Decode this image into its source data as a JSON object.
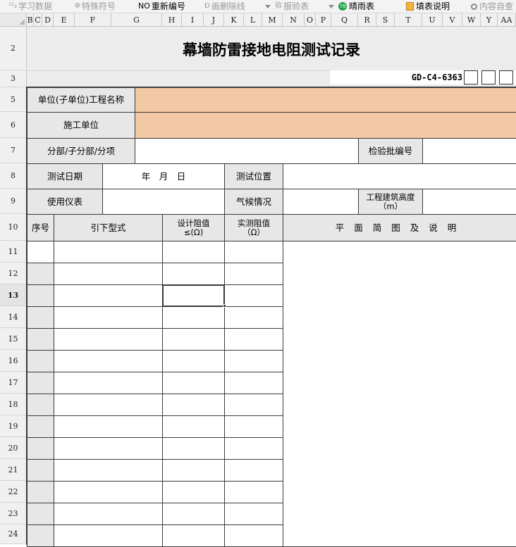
{
  "toolbar": {
    "items": [
      {
        "icon": "123-icon",
        "glyph": "¹²₃",
        "label": "学习数据",
        "disabled": true
      },
      {
        "icon": "special-symbol-icon",
        "glyph": "Φ",
        "label": "特殊符号",
        "disabled": true
      },
      {
        "icon": "number-icon",
        "glyph": "NO",
        "label": "重新编号",
        "disabled": false
      },
      {
        "icon": "strike-icon",
        "glyph": "Ð",
        "label": "画删除线",
        "disabled": true
      },
      {
        "icon": "report-icon",
        "glyph": "验",
        "label": "报验表",
        "disabled": true
      },
      {
        "icon": "weather-icon",
        "glyph": "78",
        "label": "晴雨表",
        "disabled": false
      },
      {
        "icon": "doc-icon",
        "glyph": "",
        "label": "填表说明",
        "disabled": false
      },
      {
        "icon": "search-icon",
        "glyph": "",
        "label": "内容自查",
        "disabled": true
      }
    ]
  },
  "columns": [
    "B",
    "C",
    "D",
    "E",
    "F",
    "G",
    "H",
    "I",
    "J",
    "K",
    "L",
    "M",
    "N",
    "O",
    "P",
    "Q",
    "R",
    "S",
    "T",
    "U",
    "V",
    "W",
    "Y",
    "AA"
  ],
  "rows": [
    "2",
    "3",
    "5",
    "6",
    "7",
    "8",
    "9",
    "10",
    "11",
    "12",
    "13",
    "14",
    "15",
    "16",
    "17",
    "18",
    "19",
    "20",
    "21",
    "22",
    "23",
    "24"
  ],
  "active_row": "13",
  "sheet": {
    "title": "幕墙防雷接地电阻测试记录",
    "code": "GD-C4-6363",
    "unit_name_label": "单位(子单位)工程名称",
    "construction_unit_label": "施工单位",
    "division_label": "分部/子分部/分项",
    "batch_no_label": "检验批编号",
    "test_date_label": "测试日期",
    "date_value": "年　月　日",
    "test_position_label": "测试位置",
    "instrument_label": "使用仪表",
    "weather_label": "气候情况",
    "height_label": "工程建筑高度（m）",
    "seq_label": "序号",
    "downlead_label": "引下型式",
    "design_res_label": "设计阻值≤(Ω)",
    "measured_res_label": "实测阻值（Ω）",
    "plan_label": "平面简图及说明"
  },
  "colors": {
    "peach": "#f2c9a4",
    "label_bg": "#e7e7e7"
  }
}
